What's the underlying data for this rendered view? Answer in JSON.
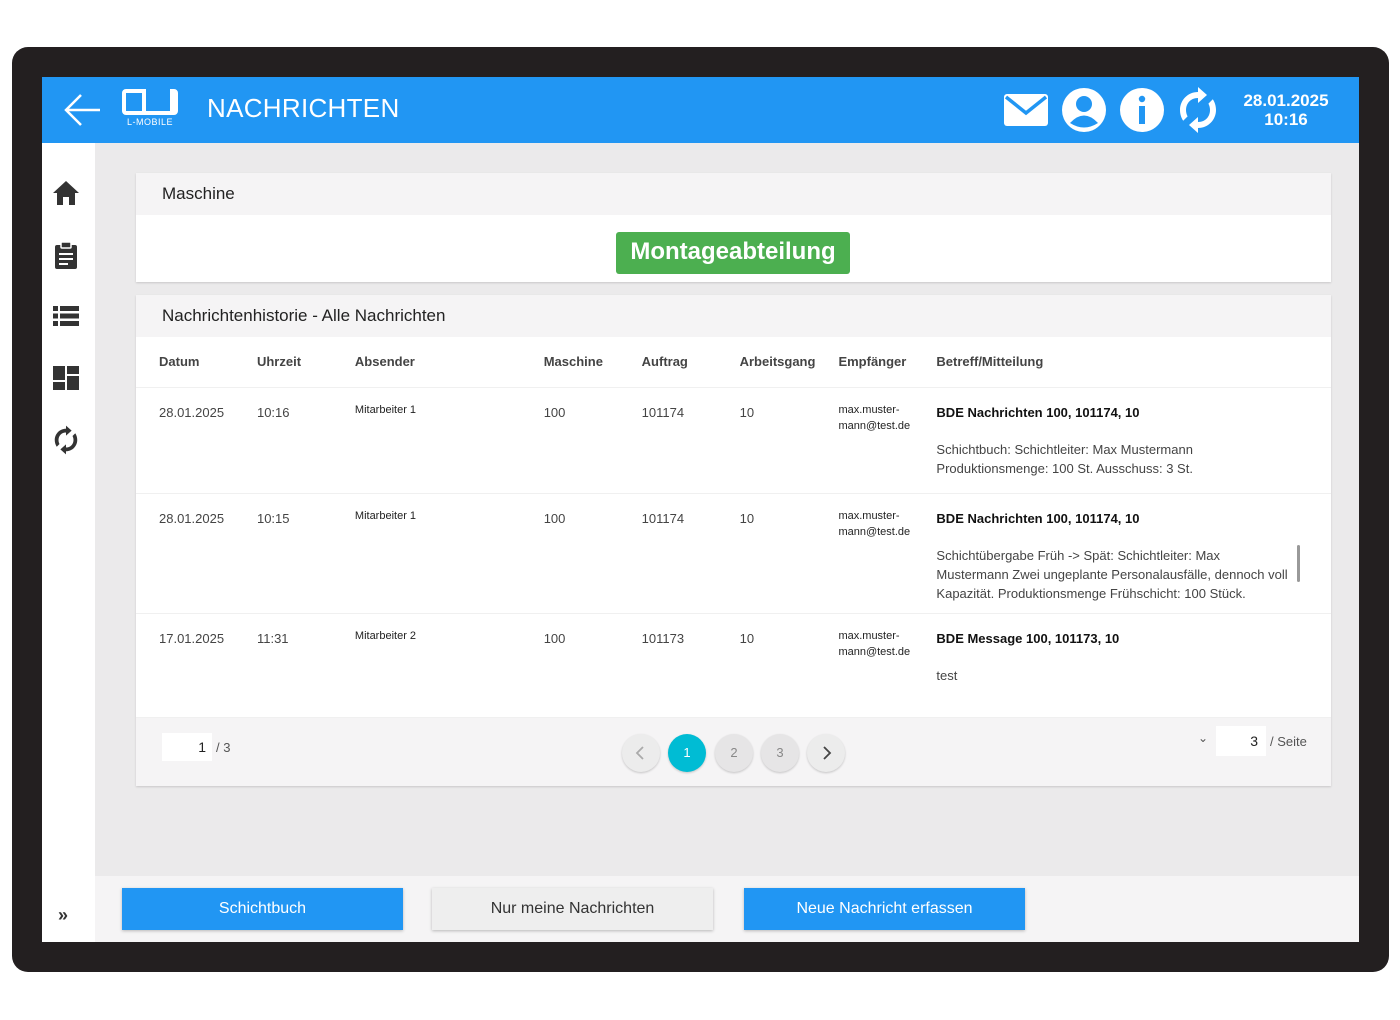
{
  "header": {
    "title": "NACHRICHTEN",
    "logo_text": "L-MOBILE",
    "date": "28.01.2025",
    "time": "10:16"
  },
  "machine_card": {
    "title": "Maschine",
    "machine_name": "Montageabteilung"
  },
  "history_card": {
    "title": "Nachrichtenhistorie - Alle Nachrichten",
    "columns": [
      "Datum",
      "Uhrzeit",
      "Absender",
      "Maschine",
      "Auftrag",
      "Arbeitsgang",
      "Empfänger",
      "Betreff/Mitteilung"
    ],
    "rows": [
      {
        "date": "28.01.2025",
        "time": "10:16",
        "sender": "Mitarbeiter 1",
        "machine": "100",
        "order": "101174",
        "operation": "10",
        "recipient": "max.muster-mann@test.de",
        "subject": "BDE Nachrichten 100, 101174, 10",
        "message": "Schichtbuch: Schichtleiter: Max Mustermann Produktionsmenge: 100 St. Ausschuss: 3 St."
      },
      {
        "date": "28.01.2025",
        "time": "10:15",
        "sender": "Mitarbeiter 1",
        "machine": "100",
        "order": "101174",
        "operation": "10",
        "recipient": "max.muster-mann@test.de",
        "subject": "BDE Nachrichten 100, 101174, 10",
        "message": "Schichtübergabe Früh -> Spät: Schichtleiter: Max Mustermann Zwei ungeplante Personalausfälle, dennoch voll Kapazität. Produktionsmenge Frühschicht: 100 Stück."
      },
      {
        "date": "17.01.2025",
        "time": "11:31",
        "sender": "Mitarbeiter 2",
        "machine": "100",
        "order": "101173",
        "operation": "10",
        "recipient": "max.muster-mann@test.de",
        "subject": "BDE Message 100, 101173, 10",
        "message": "test"
      }
    ]
  },
  "pagination": {
    "current_page": "1",
    "total_pages": "/ 3",
    "pages": [
      "1",
      "2",
      "3"
    ],
    "per_page": "3",
    "per_page_label": "/ Seite"
  },
  "actions": {
    "shift_book": "Schichtbuch",
    "my_messages": "Nur meine Nachrichten",
    "new_message": "Neue Nachricht erfassen"
  },
  "colors": {
    "primary": "#2196f3",
    "success": "#4caf50",
    "page_active": "#00bcd4"
  },
  "icons": [
    "back-arrow-icon",
    "mail-icon",
    "user-icon",
    "info-icon",
    "sync-icon",
    "home-icon",
    "clipboard-icon",
    "list-icon",
    "dashboard-icon",
    "refresh-icon",
    "expand-icon"
  ]
}
